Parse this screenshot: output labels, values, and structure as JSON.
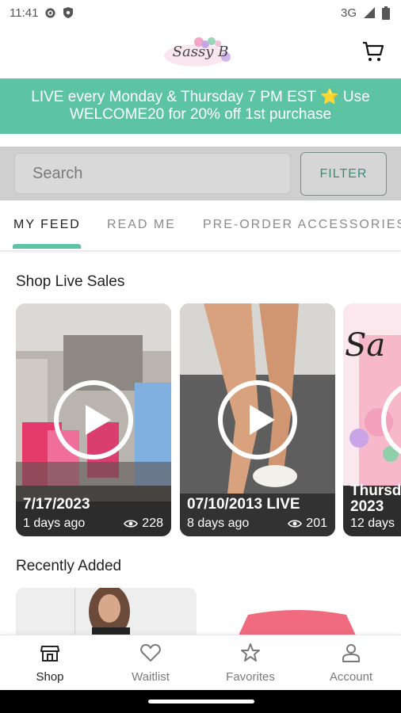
{
  "status_bar": {
    "time": "11:41",
    "network": "3G"
  },
  "header": {
    "logo_text": "Sassy B"
  },
  "banner": {
    "line1": "LIVE every Monday & Thursday 7 PM EST ⭐ Use",
    "line2": "WELCOME20 for 20% off 1st purchase"
  },
  "search": {
    "placeholder": "Search",
    "filter_label": "FILTER"
  },
  "tabs": [
    {
      "label": "MY FEED"
    },
    {
      "label": "READ ME"
    },
    {
      "label": "PRE-ORDER ACCESSORIES"
    }
  ],
  "sections": {
    "live_title": "Shop Live Sales",
    "recent_title": "Recently Added"
  },
  "live_cards": [
    {
      "date": "7/17/2023",
      "ago": "1 days ago",
      "views": "228"
    },
    {
      "date": "07/10/2013 LIVE",
      "ago": "8 days ago",
      "views": "201"
    },
    {
      "date": "Thursd",
      "date2": "2023",
      "ago": "12 days",
      "logo_text": "Sa"
    }
  ],
  "bottom_nav": [
    {
      "label": "Shop",
      "icon": "shop-icon"
    },
    {
      "label": "Waitlist",
      "icon": "heart-icon"
    },
    {
      "label": "Favorites",
      "icon": "star-icon"
    },
    {
      "label": "Account",
      "icon": "account-icon"
    }
  ],
  "colors": {
    "accent": "#5cc4a3",
    "filter_text": "#3d8d76"
  }
}
